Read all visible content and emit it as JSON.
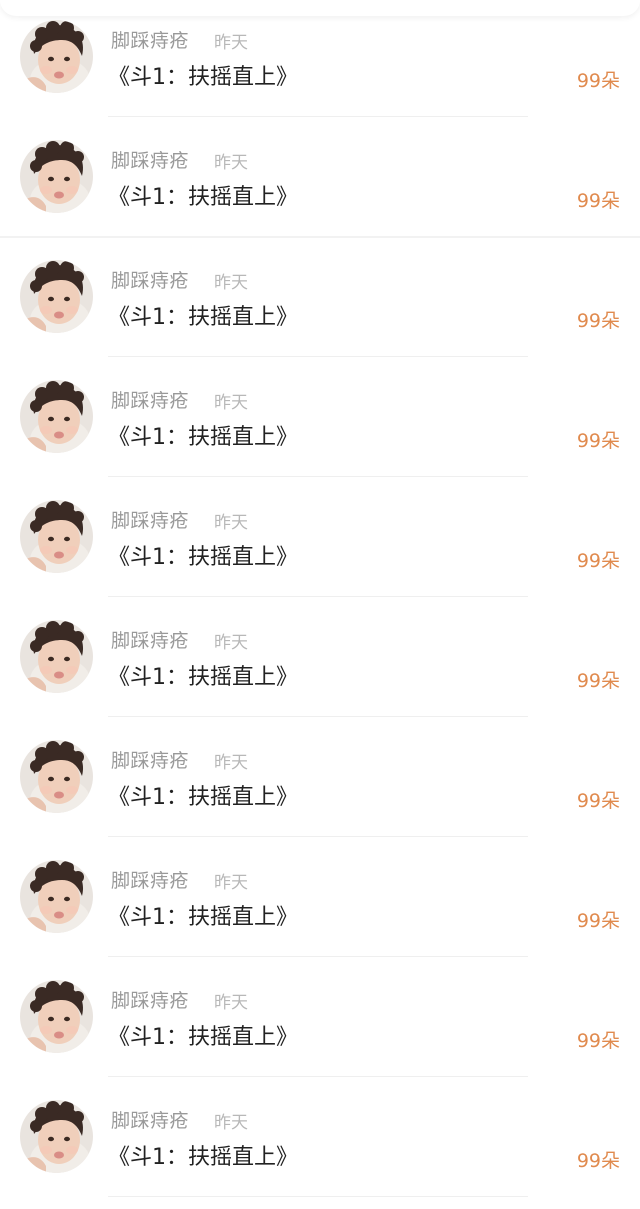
{
  "colors": {
    "gift": "#e08a4e",
    "name": "#999999",
    "time": "#b8b8b8",
    "title": "#222222"
  },
  "items": [
    {
      "name": "脚踩痔疮",
      "time": "昨天",
      "title": "《斗1：扶摇直上》",
      "gift": "99朵",
      "avatar": "baby-avatar"
    },
    {
      "name": "脚踩痔疮",
      "time": "昨天",
      "title": "《斗1：扶摇直上》",
      "gift": "99朵",
      "avatar": "baby-avatar"
    },
    {
      "name": "脚踩痔疮",
      "time": "昨天",
      "title": "《斗1：扶摇直上》",
      "gift": "99朵",
      "avatar": "baby-avatar"
    },
    {
      "name": "脚踩痔疮",
      "time": "昨天",
      "title": "《斗1：扶摇直上》",
      "gift": "99朵",
      "avatar": "baby-avatar"
    },
    {
      "name": "脚踩痔疮",
      "time": "昨天",
      "title": "《斗1：扶摇直上》",
      "gift": "99朵",
      "avatar": "baby-avatar"
    },
    {
      "name": "脚踩痔疮",
      "time": "昨天",
      "title": "《斗1：扶摇直上》",
      "gift": "99朵",
      "avatar": "baby-avatar"
    },
    {
      "name": "脚踩痔疮",
      "time": "昨天",
      "title": "《斗1：扶摇直上》",
      "gift": "99朵",
      "avatar": "baby-avatar"
    },
    {
      "name": "脚踩痔疮",
      "time": "昨天",
      "title": "《斗1：扶摇直上》",
      "gift": "99朵",
      "avatar": "baby-avatar"
    },
    {
      "name": "脚踩痔疮",
      "time": "昨天",
      "title": "《斗1：扶摇直上》",
      "gift": "99朵",
      "avatar": "baby-avatar"
    },
    {
      "name": "脚踩痔疮",
      "time": "昨天",
      "title": "《斗1：扶摇直上》",
      "gift": "99朵",
      "avatar": "baby-avatar"
    }
  ]
}
